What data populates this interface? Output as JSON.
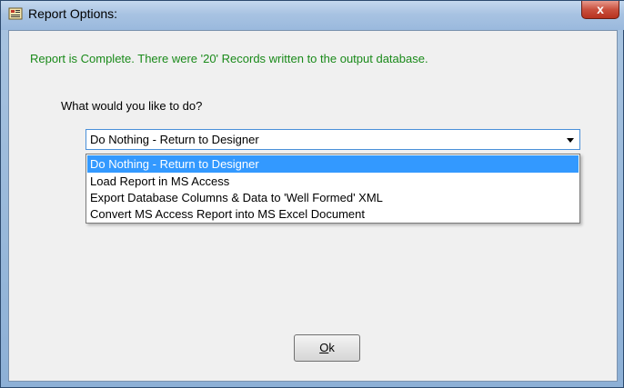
{
  "window": {
    "title": "Report Options:",
    "close_label": "x"
  },
  "status_message": "Report is Complete.  There were '20' Records written to the output database.",
  "question": "What would you like to do?",
  "action_select": {
    "selected_value": "Do Nothing - Return to Designer",
    "options": [
      "Do Nothing - Return to Designer",
      "Load Report in MS Access",
      "Export Database Columns & Data to 'Well Formed' XML",
      "Convert MS Access Report into MS Excel Document"
    ],
    "highlighted_index": 0
  },
  "ok_button": {
    "mnemonic": "O",
    "rest": "k"
  },
  "colors": {
    "status_text": "#1a8a1a",
    "selection_highlight": "#3399ff",
    "focus_border": "#4a90d9"
  }
}
